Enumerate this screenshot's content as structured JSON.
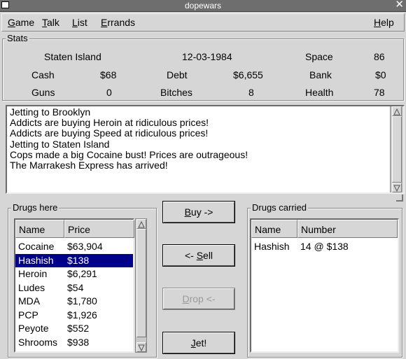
{
  "window": {
    "title": "dopewars"
  },
  "menu": {
    "game": {
      "u": "G",
      "rest": "ame"
    },
    "talk": {
      "u": "T",
      "rest": "alk"
    },
    "list": {
      "u": "L",
      "rest": "ist"
    },
    "errands": {
      "u": "E",
      "rest": "rrands"
    },
    "help": {
      "u": "H",
      "rest": "elp"
    }
  },
  "stats": {
    "label": "Stats",
    "location": "Staten Island",
    "date": "12-03-1984",
    "space_label": "Space",
    "space": "86",
    "cash_label": "Cash",
    "cash": "$68",
    "debt_label": "Debt",
    "debt": "$6,655",
    "bank_label": "Bank",
    "bank": "$0",
    "guns_label": "Guns",
    "guns": "0",
    "bitches_label": "Bitches",
    "bitches": "8",
    "health_label": "Health",
    "health": "78"
  },
  "log": [
    "Jetting to Brooklyn",
    "Addicts are buying Heroin at ridiculous prices!",
    "Addicts are buying Speed at ridiculous prices!",
    "Jetting to Staten Island",
    "Cops made a big Cocaine bust! Prices are outrageous!",
    "The Marrakesh Express has arrived!"
  ],
  "drugs_here": {
    "label": "Drugs here",
    "col_name": "Name",
    "col_price": "Price",
    "rows": [
      {
        "name": "Cocaine",
        "price": "$63,904"
      },
      {
        "name": "Hashish",
        "price": "$138"
      },
      {
        "name": "Heroin",
        "price": "$6,291"
      },
      {
        "name": "Ludes",
        "price": "$54"
      },
      {
        "name": "MDA",
        "price": "$1,780"
      },
      {
        "name": "PCP",
        "price": "$1,926"
      },
      {
        "name": "Peyote",
        "price": "$552"
      },
      {
        "name": "Shrooms",
        "price": "$938"
      }
    ],
    "selected": "Hashish"
  },
  "buttons": {
    "buy": {
      "u": "B",
      "rest": "uy ->"
    },
    "sell": {
      "pre": "<- ",
      "u": "S",
      "rest": "ell"
    },
    "drop": {
      "u": "D",
      "rest": "rop <-"
    },
    "jet": {
      "u": "J",
      "rest": "et!"
    }
  },
  "drugs_carried": {
    "label": "Drugs carried",
    "col_name": "Name",
    "col_number": "Number",
    "rows": [
      {
        "name": "Hashish",
        "number": "14 @ $138"
      }
    ]
  },
  "colors": {
    "selection": "#00008b",
    "title_bar": "#6e6e6e",
    "background": "#d6d6d6"
  }
}
